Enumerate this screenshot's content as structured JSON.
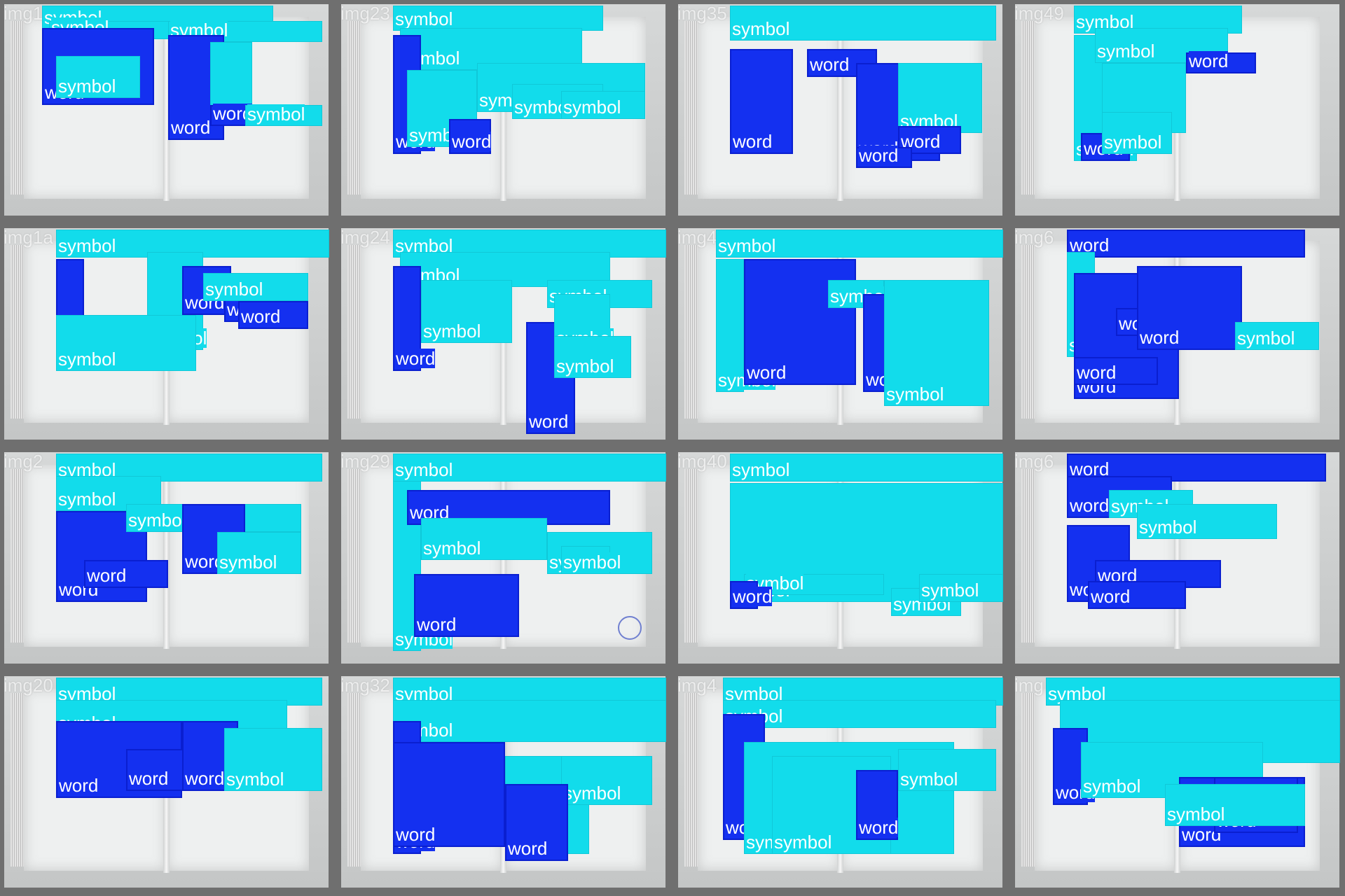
{
  "grid": {
    "tiles": [
      {
        "label": "img1",
        "boxes": [
          {
            "cls": "symbol",
            "text": "symbol"
          },
          {
            "cls": "symbol",
            "text": "symbol"
          },
          {
            "cls": "word",
            "text": "word"
          },
          {
            "cls": "symbol",
            "text": "symbol"
          },
          {
            "cls": "symbol",
            "text": "symbol"
          },
          {
            "cls": "word",
            "text": "word"
          },
          {
            "cls": "symbol",
            "text": "symbol"
          },
          {
            "cls": "word",
            "text": "word"
          },
          {
            "cls": "symbol",
            "text": "symbol"
          }
        ]
      },
      {
        "label": "img23",
        "boxes": [
          {
            "cls": "symbol",
            "text": "symbol"
          },
          {
            "cls": "symbol",
            "text": "symbol"
          },
          {
            "cls": "word",
            "text": "word"
          },
          {
            "cls": "symbol",
            "text": "symbol"
          },
          {
            "cls": "symbol",
            "text": "symbol"
          },
          {
            "cls": "symbol",
            "text": "symbol"
          },
          {
            "cls": "word",
            "text": "word"
          },
          {
            "cls": "symbol",
            "text": "symbol"
          }
        ]
      },
      {
        "label": "img35",
        "boxes": [
          {
            "cls": "symbol",
            "text": "symbol"
          },
          {
            "cls": "word",
            "text": "word"
          },
          {
            "cls": "word",
            "text": "word"
          },
          {
            "cls": "word",
            "text": "word"
          },
          {
            "cls": "symbol",
            "text": "symbol"
          },
          {
            "cls": "word",
            "text": "word"
          },
          {
            "cls": "word",
            "text": "word"
          }
        ]
      },
      {
        "label": "img49",
        "boxes": [
          {
            "cls": "symbol",
            "text": "symbol"
          },
          {
            "cls": "symbol",
            "text": "symbol"
          },
          {
            "cls": "symbol",
            "text": "symbol"
          },
          {
            "cls": "word",
            "text": "word"
          },
          {
            "cls": "symbol",
            "text": "symbol"
          },
          {
            "cls": "word",
            "text": "word"
          },
          {
            "cls": "symbol",
            "text": "symbol"
          }
        ]
      },
      {
        "label": "img1a",
        "boxes": [
          {
            "cls": "symbol",
            "text": "symbol"
          },
          {
            "cls": "word",
            "text": "word"
          },
          {
            "cls": "symbol",
            "text": "symbol"
          },
          {
            "cls": "word",
            "text": "word"
          },
          {
            "cls": "word",
            "text": "word"
          },
          {
            "cls": "word",
            "text": "word"
          },
          {
            "cls": "symbol",
            "text": "symbol"
          },
          {
            "cls": "symbol",
            "text": "symbol"
          }
        ]
      },
      {
        "label": "img24",
        "boxes": [
          {
            "cls": "symbol",
            "text": "symbol"
          },
          {
            "cls": "symbol",
            "text": "symbol"
          },
          {
            "cls": "word",
            "text": "word"
          },
          {
            "cls": "symbol",
            "text": "symbol"
          },
          {
            "cls": "symbol",
            "text": "symbol"
          },
          {
            "cls": "word",
            "text": "word"
          },
          {
            "cls": "symbol",
            "text": "symbol"
          },
          {
            "cls": "symbol",
            "text": "symbol"
          }
        ]
      },
      {
        "label": "img40",
        "boxes": [
          {
            "cls": "symbol",
            "text": "symbol"
          },
          {
            "cls": "symbol",
            "text": "symbol"
          },
          {
            "cls": "word",
            "text": "word"
          },
          {
            "cls": "symbol",
            "text": "symbol"
          },
          {
            "cls": "word",
            "text": "word"
          },
          {
            "cls": "symbol",
            "text": "symbol"
          }
        ]
      },
      {
        "label": "img6",
        "boxes": [
          {
            "cls": "word",
            "text": "word"
          },
          {
            "cls": "symbol",
            "text": "symbol"
          },
          {
            "cls": "word",
            "text": "word"
          },
          {
            "cls": "word",
            "text": "word"
          },
          {
            "cls": "word",
            "text": "word"
          },
          {
            "cls": "word",
            "text": "word"
          },
          {
            "cls": "symbol",
            "text": "symbol"
          }
        ]
      },
      {
        "label": "img2",
        "boxes": [
          {
            "cls": "symbol",
            "text": "symbol"
          },
          {
            "cls": "symbol",
            "text": "symbol"
          },
          {
            "cls": "word",
            "text": "word"
          },
          {
            "cls": "symbol",
            "text": "symbol"
          },
          {
            "cls": "word",
            "text": "word"
          },
          {
            "cls": "symbol",
            "text": "symbol"
          },
          {
            "cls": "word",
            "text": "word"
          }
        ]
      },
      {
        "label": "img29",
        "boxes": [
          {
            "cls": "symbol",
            "text": "symbol"
          },
          {
            "cls": "symbol",
            "text": "symbol"
          },
          {
            "cls": "word",
            "text": "word"
          },
          {
            "cls": "symbol",
            "text": "symbol"
          },
          {
            "cls": "symbol",
            "text": "symbol"
          },
          {
            "cls": "symbol",
            "text": "symbol"
          },
          {
            "cls": "word",
            "text": "word"
          },
          {
            "cls": "symbol",
            "text": "symbol"
          }
        ]
      },
      {
        "label": "img40",
        "boxes": [
          {
            "cls": "symbol",
            "text": "symbol"
          },
          {
            "cls": "symbol",
            "text": "symbol"
          },
          {
            "cls": "symbol",
            "text": "symbol"
          },
          {
            "cls": "word",
            "text": "word"
          },
          {
            "cls": "symbol",
            "text": "symbol"
          },
          {
            "cls": "symbol",
            "text": "symbol"
          }
        ]
      },
      {
        "label": "img6",
        "boxes": [
          {
            "cls": "word",
            "text": "word"
          },
          {
            "cls": "word",
            "text": "word"
          },
          {
            "cls": "symbol",
            "text": "symbol"
          },
          {
            "cls": "word",
            "text": "word"
          },
          {
            "cls": "symbol",
            "text": "symbol"
          },
          {
            "cls": "word",
            "text": "word"
          },
          {
            "cls": "word",
            "text": "word"
          }
        ]
      },
      {
        "label": "img20",
        "boxes": [
          {
            "cls": "symbol",
            "text": "symbol"
          },
          {
            "cls": "symbol",
            "text": "symbol"
          },
          {
            "cls": "word",
            "text": "word"
          },
          {
            "cls": "word",
            "text": "word"
          },
          {
            "cls": "word",
            "text": "word"
          },
          {
            "cls": "symbol",
            "text": "symbol"
          }
        ]
      },
      {
        "label": "img32",
        "boxes": [
          {
            "cls": "symbol",
            "text": "symbol"
          },
          {
            "cls": "symbol",
            "text": "symbol"
          },
          {
            "cls": "word",
            "text": "word"
          },
          {
            "cls": "word",
            "text": "word"
          },
          {
            "cls": "symbol",
            "text": "symbol"
          },
          {
            "cls": "symbol",
            "text": "symbol"
          },
          {
            "cls": "word",
            "text": "word"
          }
        ]
      },
      {
        "label": "img4",
        "boxes": [
          {
            "cls": "symbol",
            "text": "symbol"
          },
          {
            "cls": "symbol",
            "text": "symbol"
          },
          {
            "cls": "word",
            "text": "word"
          },
          {
            "cls": "symbol",
            "text": "symbol"
          },
          {
            "cls": "symbol",
            "text": "symbol"
          },
          {
            "cls": "symbol",
            "text": "symbol"
          },
          {
            "cls": "word",
            "text": "word"
          }
        ]
      },
      {
        "label": "img",
        "boxes": [
          {
            "cls": "symbol",
            "text": "symbol"
          },
          {
            "cls": "symbol",
            "text": "symbol"
          },
          {
            "cls": "word",
            "text": "word"
          },
          {
            "cls": "symbol",
            "text": "symbol"
          },
          {
            "cls": "word",
            "text": "word"
          },
          {
            "cls": "word",
            "text": "word"
          },
          {
            "cls": "symbol",
            "text": "symbol"
          }
        ]
      }
    ]
  },
  "colors": {
    "word": "#1430f0",
    "symbol": "#12dceb",
    "background": "#6f6f6f"
  }
}
